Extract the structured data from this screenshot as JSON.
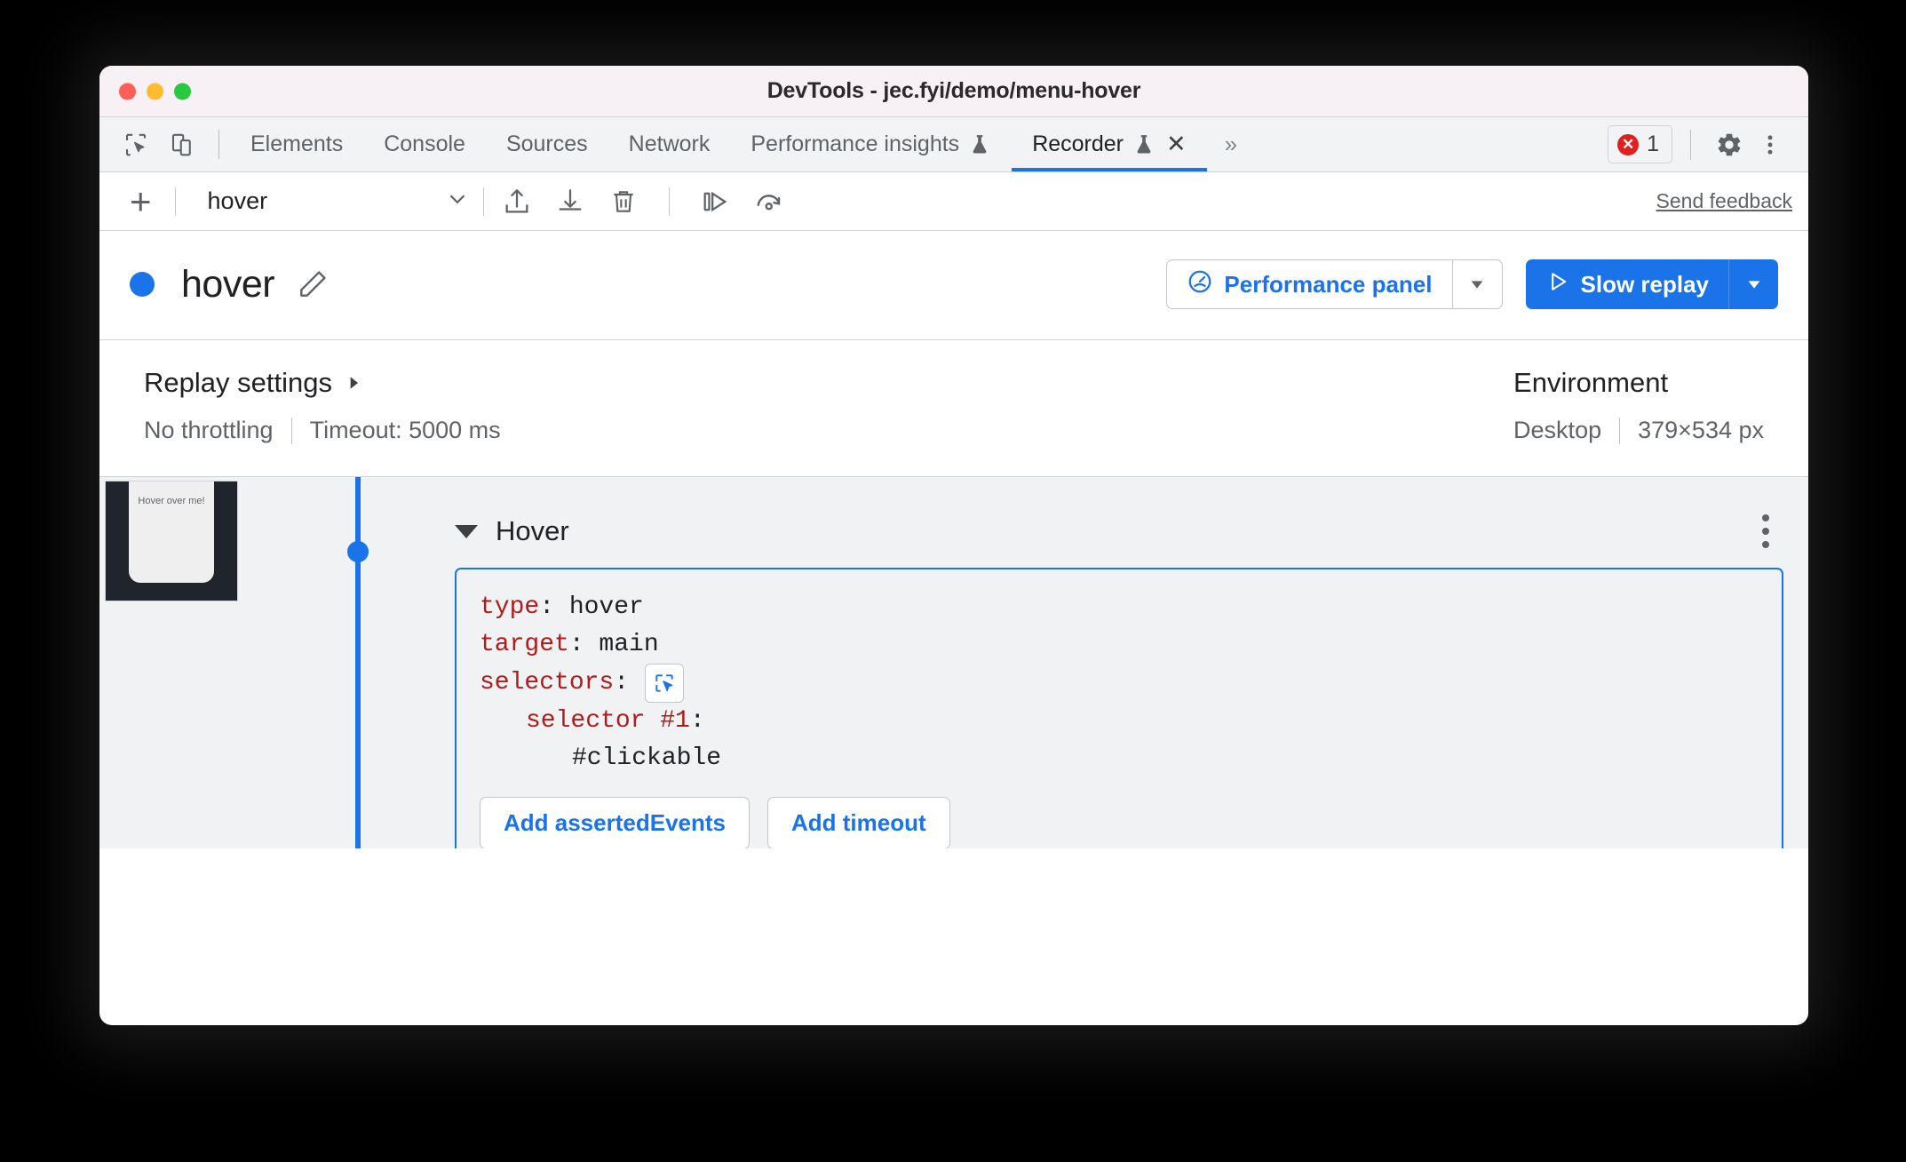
{
  "window": {
    "title": "DevTools - jec.fyi/demo/menu-hover",
    "traffic_lights": [
      "close",
      "minimize",
      "zoom"
    ]
  },
  "tabbar": {
    "left_icons": [
      "inspect-element-icon",
      "device-toolbar-icon"
    ],
    "tabs": [
      {
        "label": "Elements",
        "active": false
      },
      {
        "label": "Console",
        "active": false
      },
      {
        "label": "Sources",
        "active": false
      },
      {
        "label": "Network",
        "active": false
      },
      {
        "label": "Performance insights",
        "active": false,
        "experimental": true
      },
      {
        "label": "Recorder",
        "active": true,
        "experimental": true,
        "closable": true
      }
    ],
    "overflow_label": "»",
    "error_count": "1",
    "error_symbol": "✕",
    "settings_icon": "gear-icon",
    "more_icon": "kebab-icon"
  },
  "recorder_toolbar": {
    "add_label": "+",
    "recording_name": "hover",
    "chevron": "chevron-down-icon",
    "actions": [
      "export-icon",
      "import-icon",
      "delete-icon",
      "step-over-icon",
      "replay-icon"
    ],
    "feedback_label": "Send feedback"
  },
  "header": {
    "status_dot_color": "#1a73e8",
    "title": "hover",
    "edit_icon": "pencil-icon",
    "performance_button": "Performance panel",
    "performance_icon": "performance-icon",
    "replay_button": "Slow replay",
    "replay_icon": "play-icon",
    "dropdown_icon": "caret-down-icon"
  },
  "settings": {
    "replay_title": "Replay settings",
    "replay_caret": "▶",
    "throttling": "No throttling",
    "timeout": "Timeout: 5000 ms",
    "environment_title": "Environment",
    "device": "Desktop",
    "viewport": "379×534 px"
  },
  "step": {
    "thumbnail_text": "Hover over me!",
    "name": "Hover",
    "menu_icon": "kebab-icon",
    "code": {
      "type_key": "type",
      "type_value": ": hover",
      "target_key": "target",
      "target_value": ": main",
      "selectors_key": "selectors",
      "selectors_value": ":",
      "selector_picker_icon": "select-element-icon",
      "selector1_key": "selector #1",
      "selector1_value": ":",
      "selector1_body": "#clickable"
    },
    "add_asserted_events": "Add assertedEvents",
    "add_timeout": "Add timeout"
  },
  "colors": {
    "accent": "#1a73e8",
    "titlebar_bg": "#f7f0f5",
    "tabbar_bg": "#f1f3f4",
    "steps_bg": "#f1f2f4",
    "code_key": "#b11b1b",
    "error_red": "#e02020"
  }
}
